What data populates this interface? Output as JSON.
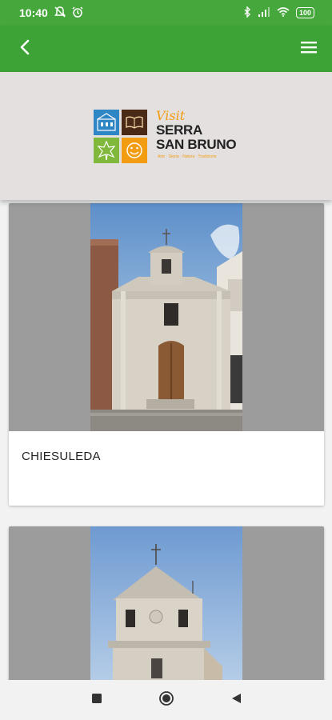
{
  "status_bar": {
    "time": "10:40",
    "battery": "100"
  },
  "app_bar": {
    "back_icon": "arrow-left-icon",
    "menu_icon": "hamburger-menu-icon",
    "color": "#3ea337"
  },
  "header": {
    "logo": {
      "visit": "Visit",
      "line1": "SERRA",
      "line2": "SAN BRUNO",
      "tagline": "Arte · Storia · Natura · Tradizione"
    }
  },
  "cards": [
    {
      "title": "CHIESULEDA",
      "image": "church-photo"
    },
    {
      "title": "",
      "image": "church-tower-photo"
    }
  ],
  "nav_bar": {
    "icons": [
      "recent-apps-icon",
      "home-icon",
      "back-icon"
    ]
  }
}
